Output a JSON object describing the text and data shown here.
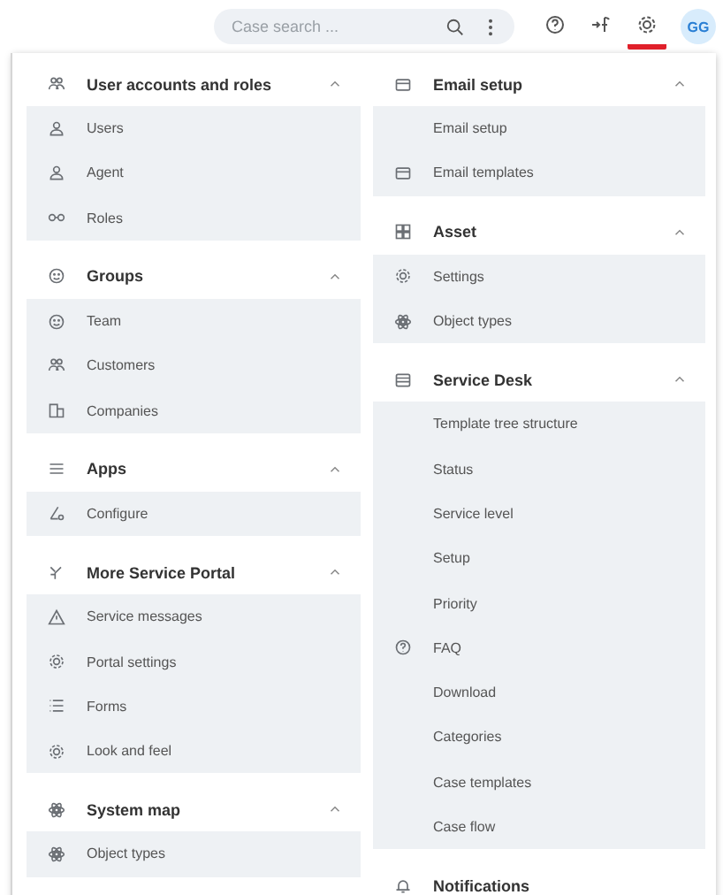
{
  "top_bar": {
    "search": {
      "placeholder": "Case search ..."
    },
    "buttons": [
      {
        "kind": "help",
        "selected": false
      },
      {
        "kind": "switch",
        "selected": false
      },
      {
        "kind": "settings",
        "selected": true
      }
    ],
    "avatar": "GG"
  },
  "menu": {
    "columns": [
      {
        "sections": [
          {
            "title": "User accounts and roles",
            "expanded": true,
            "items": [
              {
                "label": "Users"
              },
              {
                "label": "Agent"
              },
              {
                "label": "Roles"
              }
            ]
          },
          {
            "title": "Groups",
            "expanded": true,
            "items": [
              {
                "label": "Team"
              },
              {
                "label": "Customers"
              },
              {
                "label": "Companies"
              }
            ]
          },
          {
            "title": "Apps",
            "expanded": true,
            "items": [
              {
                "label": "Configure"
              }
            ]
          },
          {
            "title": "More Service Portal",
            "expanded": true,
            "items": [
              {
                "label": "Service messages"
              },
              {
                "label": "Portal settings"
              },
              {
                "label": "Forms"
              },
              {
                "label": "Look and feel"
              }
            ]
          },
          {
            "title": "System map",
            "expanded": true,
            "items": [
              {
                "label": "Object types"
              }
            ]
          }
        ]
      },
      {
        "sections": [
          {
            "title": "Email setup",
            "expanded": true,
            "items": [
              {
                "label": "Email setup"
              },
              {
                "label": "Email templates"
              }
            ]
          },
          {
            "title": "Asset",
            "expanded": true,
            "items": [
              {
                "label": "Settings"
              },
              {
                "label": "Object types"
              }
            ]
          },
          {
            "title": "Service Desk",
            "expanded": true,
            "items": [
              {
                "label": "Template tree structure"
              },
              {
                "label": "Status"
              },
              {
                "label": "Service level"
              },
              {
                "label": "Setup"
              },
              {
                "label": "Priority"
              },
              {
                "label": "FAQ"
              },
              {
                "label": "Download"
              },
              {
                "label": "Categories"
              },
              {
                "label": "Case templates"
              },
              {
                "label": "Case flow"
              }
            ]
          },
          {
            "title": "Notifications"
          }
        ]
      }
    ]
  }
}
